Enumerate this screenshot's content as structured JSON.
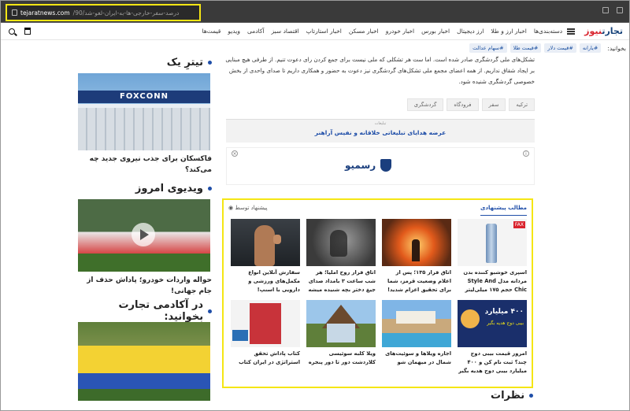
{
  "browser": {
    "url_domain": "tejaratnews.com",
    "url_path": "/درصد-سفر-خارجی-ها-به-ایران-لغو-شد/90"
  },
  "nav": {
    "logo_main": "تجارت",
    "logo_accent": "نیوز",
    "items": [
      "دسته‌بندی‌ها",
      "اخبار ارز و طلا",
      "ارز دیجیتال",
      "اخبار بورس",
      "اخبار خودرو",
      "اخبار مسکن",
      "اخبار استارتاپ",
      "اقتصاد سبز",
      "آکادمی",
      "ویدیو",
      "قیمت‌ها"
    ]
  },
  "tags_bar": {
    "label": "بخوانید:",
    "tags": [
      "#یارانه",
      "#قیمت دلار",
      "#قیمت طلا",
      "#سهام عدالت"
    ]
  },
  "article": {
    "paragraph": "تشکل‌های ملی گردشگری صادر شده است. اما ست هر تشکلی که ملی نیست برای جمع کردن رای دعوت تنیم. از طرفی هیچ مبنایی بر ایجاد شقاق نداریم. از همه اعضای مجمع ملی تشکل‌های گردشگری نیز دعوت به حضور و همکاری داریم تا صدای واحدی از بخش خصوصی گردشگری شنیده شود.",
    "tags": [
      "ترکیه",
      "سفر",
      "فرودگاه",
      "گردشگری"
    ]
  },
  "ad": {
    "label": "تبلیغات",
    "text": "عرضه هدایای تبلیغاتی خلاقانه و نفیس آراهنر",
    "rasmio": "رسمیو"
  },
  "recommended": {
    "title": "مطالب پیشنهادی",
    "sponsor": "پیشنهاد توسط",
    "items": [
      {
        "title": "اسپری خوشبو کننده بدن مردانه مدل Style And Chic حجم ۱۷۵ میلی‌لیتر"
      },
      {
        "title": "اتاق فرار ۱۳۵؛ پس از اعلام وضعیت قرمز، شما برای تحقیق اعزام شدید!"
      },
      {
        "title": "اتاق فرار روح املیا؛ هر شب ساعت ۳ بامداد صدای جیغ دختر بچه شنیده میشه"
      },
      {
        "title": "سفارش آنلاین انواع مکمل‌های ورزشی و دارویی با اسنپ!"
      },
      {
        "title": "امروز قیمت بیبی دوج چند؟ ثبت نام کن و ۴۰۰ میلیارد بیبی دوج هدیه بگیر"
      },
      {
        "title": "اجاره ویلاها و سوئیت‌های شمال در میهمان شو"
      },
      {
        "title": "ویلا کلبه سوئیسی کلاردشت دور تا دور پنجره"
      },
      {
        "title": "کتاب پاداش تحقق استراتژی در ایران کتاب"
      }
    ],
    "badge": "FAX",
    "doge_text": "۴۰۰ میلیارد",
    "doge_sub": "بیبی دوج هدیه بگیر"
  },
  "sidebar": {
    "tiztik_title": "تیترِ یک",
    "foxconn_label": "FOXCONN",
    "tiztik_caption": "فاکسکان برای جذب نیروی جدید چه می‌کند؟",
    "video_title": "ویدیوی امروز",
    "video_caption": "حواله واردات خودرو؛ پاداش حذف از جام جهانی!",
    "academy_title": "در آکادمی تجارت بخوانید:"
  },
  "footer": {
    "comments_title": "نظرات"
  },
  "colors": {
    "accent": "#1f4ea8",
    "highlight": "#f5e614",
    "brand_red": "#d9232d"
  }
}
